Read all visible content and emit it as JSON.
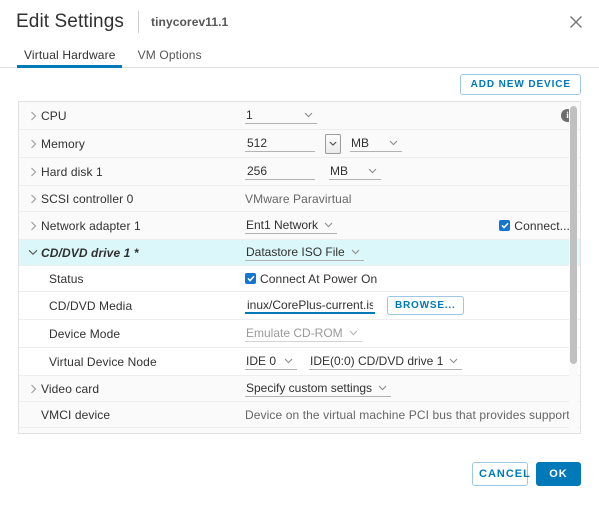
{
  "header": {
    "title": "Edit Settings",
    "vm_name": "tinycorev11.1",
    "close_icon": "close-icon"
  },
  "tabs": [
    {
      "label": "Virtual Hardware",
      "active": true
    },
    {
      "label": "VM Options",
      "active": false
    }
  ],
  "toolbar": {
    "add_new_device_label": "ADD NEW DEVICE"
  },
  "rows": {
    "cpu": {
      "label": "CPU",
      "value": "1",
      "info_icon": "info-icon"
    },
    "memory": {
      "label": "Memory",
      "value": "512",
      "unit": "MB",
      "spinner_icon": "caret-down-icon"
    },
    "hard_disk": {
      "label": "Hard disk 1",
      "value": "256",
      "unit": "MB"
    },
    "scsi_controller": {
      "label": "SCSI controller 0",
      "value": "VMware Paravirtual"
    },
    "network_adapter": {
      "label": "Network adapter 1",
      "value": "Ent1 Network",
      "connect_label": "Connect...",
      "connect_checked": true
    },
    "cddvd_drive": {
      "label": "CD/DVD drive 1 *",
      "value": "Datastore ISO File",
      "expanded": true
    },
    "status": {
      "label": "Status",
      "checkbox_label": "Connect At Power On",
      "checked": true
    },
    "cddvd_media": {
      "label": "CD/DVD Media",
      "value": "inux/CorePlus-current.iso",
      "browse_label": "BROWSE..."
    },
    "device_mode": {
      "label": "Device Mode",
      "value": "Emulate CD-ROM"
    },
    "virtual_device_node": {
      "label": "Virtual Device Node",
      "bus": "IDE 0",
      "node": "IDE(0:0) CD/DVD drive 1"
    },
    "video_card": {
      "label": "Video card",
      "value": "Specify custom settings"
    },
    "vmci_device": {
      "label": "VMCI device",
      "value": "Device on the virtual machine PCI bus that provides support for the"
    }
  },
  "footer": {
    "cancel_label": "CANCEL",
    "ok_label": "OK"
  },
  "colors": {
    "accent": "#0079b8",
    "highlight_row": "#dbf7f9",
    "checkbox": "#1675d1"
  }
}
